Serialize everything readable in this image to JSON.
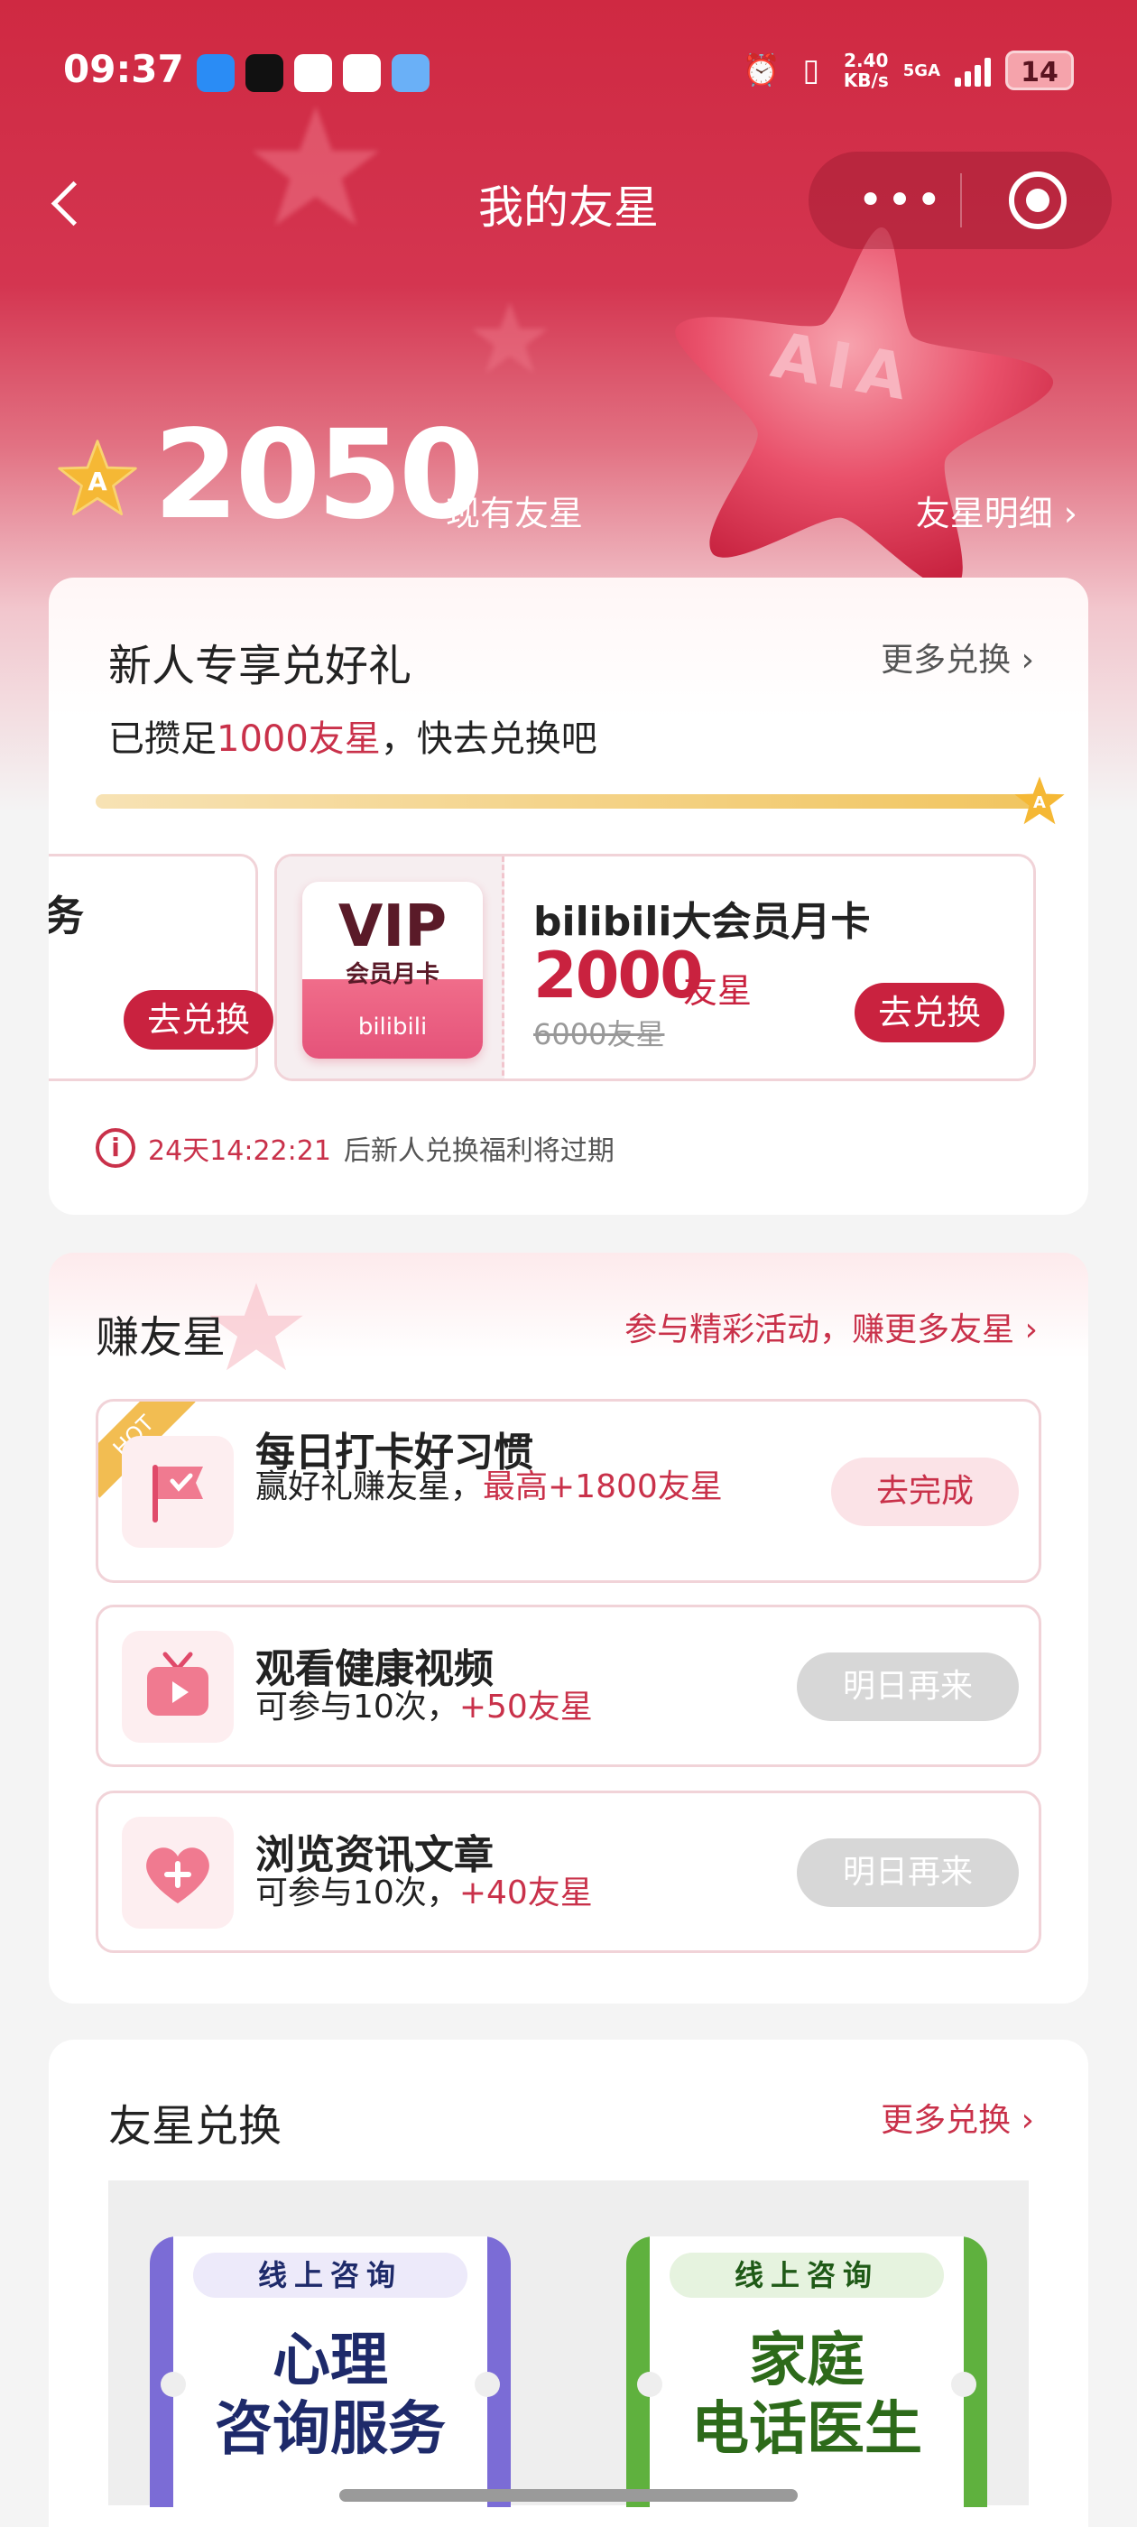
{
  "status_bar": {
    "time": "09:37",
    "speed_value": "2.40",
    "speed_unit": "KB/s",
    "network": "5GA",
    "battery": "14"
  },
  "nav": {
    "title": "我的友星",
    "more_icon": "•••"
  },
  "balance": {
    "value": "2050",
    "label": "现有友星",
    "detail_link": "友星明细 ›",
    "coin_letter": "A",
    "decor_text": "AIA"
  },
  "newcomer": {
    "title": "新人专享兑好礼",
    "more": "更多兑换 ›",
    "sub_prefix": "已攒足",
    "sub_highlight": "1000友星",
    "sub_suffix": "，快去兑换吧",
    "progress": 1.0,
    "left_fragment": "务",
    "left_button": "去兑换",
    "gift": {
      "thumb_vip": "VIP",
      "thumb_sub": "会员月卡",
      "thumb_brand": "bilibili",
      "name": "bilibili大会员月卡",
      "price": "2000",
      "unit": "友星",
      "old_price": "6000友星",
      "button": "去兑换"
    },
    "expire_countdown": "24天14:22:21",
    "expire_text": "后新人兑换福利将过期"
  },
  "earn": {
    "title": "赚友星",
    "more": "参与精彩活动，赚更多友星 ›",
    "tasks": [
      {
        "icon": "flag-check-icon",
        "badge": "HOT",
        "name": "每日打卡好习惯",
        "desc_prefix": "赢好礼赚友星，",
        "desc_highlight": "最高+1800友星",
        "button": "去完成"
      },
      {
        "icon": "video-tv-icon",
        "name": "观看健康视频",
        "desc_prefix": "可参与10次，",
        "desc_highlight": "+50友星",
        "button": "明日再来"
      },
      {
        "icon": "heart-plus-icon",
        "name": "浏览资讯文章",
        "desc_prefix": "可参与10次，",
        "desc_highlight": "+40友星",
        "button": "明日再来"
      }
    ]
  },
  "exchange": {
    "title": "友星兑换",
    "more": "更多兑换 ›",
    "items": [
      {
        "tag": "线上咨询",
        "line1": "心理",
        "line2": "咨询服务",
        "color": "#7b6cd6"
      },
      {
        "tag": "线上咨询",
        "line1": "家庭",
        "line2": "电话医生",
        "color": "#5fb13e"
      }
    ]
  },
  "colors": {
    "brand_red": "#c9223f",
    "hero_top": "#cf2942"
  }
}
